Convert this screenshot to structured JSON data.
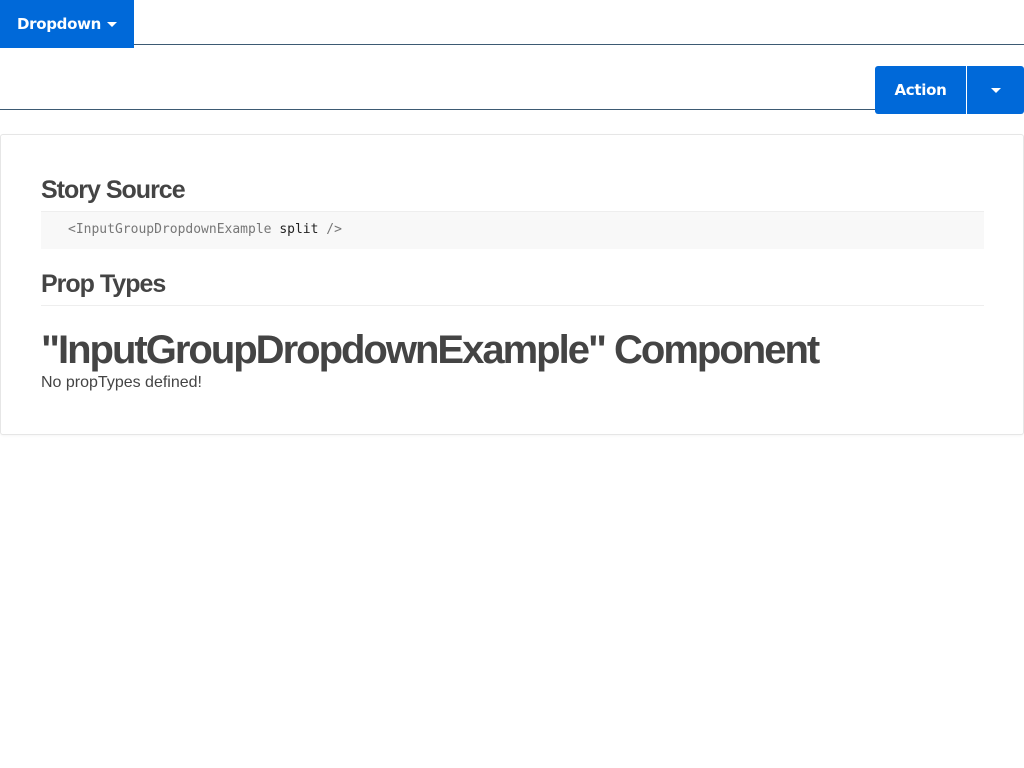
{
  "toolbar": {
    "dropdown_label": "Dropdown",
    "action_label": "Action"
  },
  "story_source": {
    "heading": "Story Source",
    "code_tag_open": "<InputGroupDropdownExample",
    "code_attr": "split",
    "code_tag_close": "/>"
  },
  "prop_types": {
    "heading": "Prop Types",
    "component_title": "\"InputGroupDropdownExample\" Component",
    "message": "No propTypes defined!"
  },
  "colors": {
    "primary": "#0069d9",
    "heading_text": "#444444",
    "code_bg": "#f8f8f8"
  },
  "icons": {
    "dropdown_caret": "chevron-down-icon",
    "split_caret": "chevron-down-icon"
  }
}
